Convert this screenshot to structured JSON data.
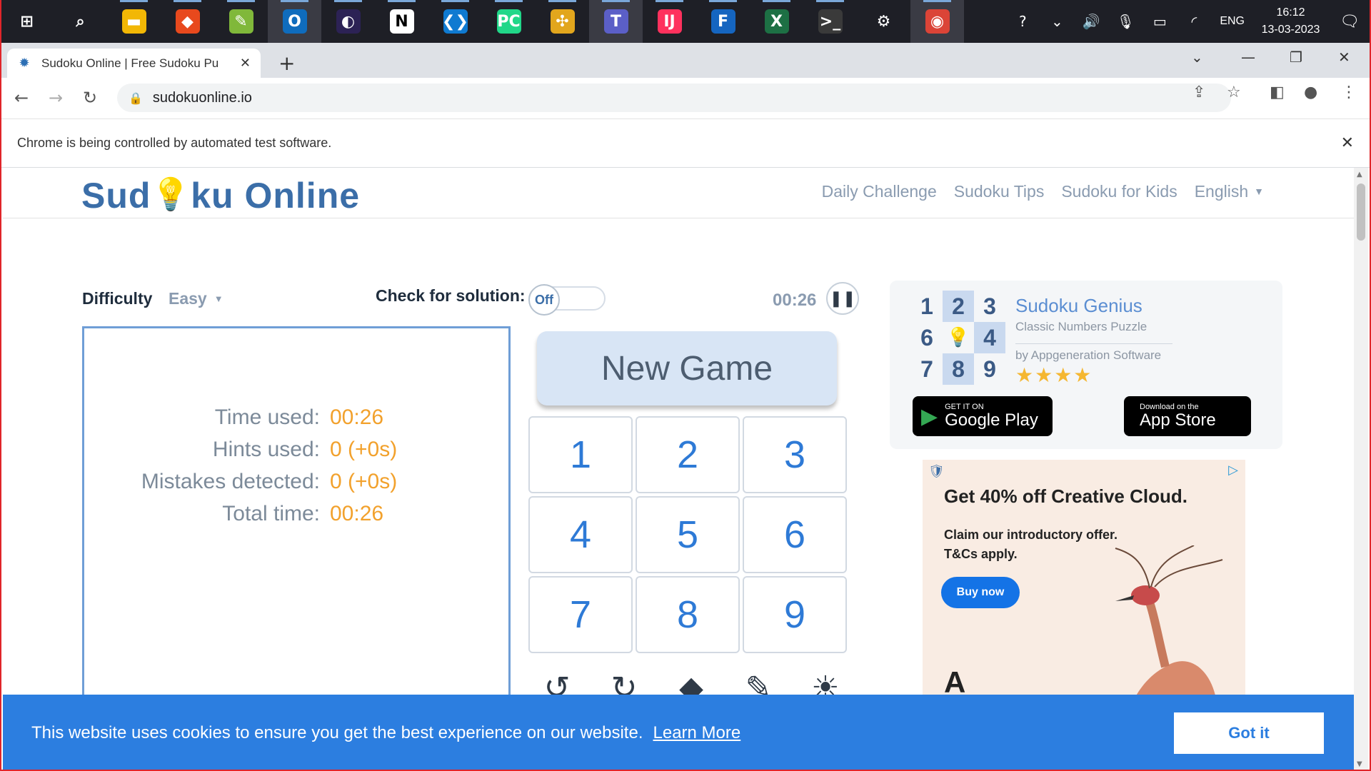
{
  "taskbar": {
    "apps": [
      {
        "name": "windows-start-icon",
        "glyph": "⊞",
        "bg": "transparent"
      },
      {
        "name": "search-icon",
        "glyph": "⌕",
        "bg": "transparent"
      },
      {
        "name": "file-explorer-icon",
        "glyph": "▬",
        "bg": "#f2b705"
      },
      {
        "name": "brave-browser-icon",
        "glyph": "◆",
        "bg": "#e8491d"
      },
      {
        "name": "notepadplusplus-icon",
        "glyph": "✎",
        "bg": "#80b83a"
      },
      {
        "name": "outlook-icon",
        "glyph": "O",
        "bg": "#0f6cbd"
      },
      {
        "name": "eclipse-icon",
        "glyph": "◐",
        "bg": "#2c2255"
      },
      {
        "name": "notion-icon",
        "glyph": "N",
        "bg": "#ffffff"
      },
      {
        "name": "vscode-icon",
        "glyph": "❮❯",
        "bg": "#0f7ad1"
      },
      {
        "name": "pycharm-icon",
        "glyph": "PC",
        "bg": "#21d789"
      },
      {
        "name": "puzzle-app-icon",
        "glyph": "✣",
        "bg": "#e2a61d"
      },
      {
        "name": "teams-icon",
        "glyph": "T",
        "bg": "#5b5fc7"
      },
      {
        "name": "intellij-icon",
        "glyph": "IJ",
        "bg": "#fe315d"
      },
      {
        "name": "f-app-icon",
        "glyph": "F",
        "bg": "#1565c0"
      },
      {
        "name": "excel-icon",
        "glyph": "X",
        "bg": "#1d7044"
      },
      {
        "name": "terminal-icon",
        "glyph": ">_",
        "bg": "#3a3a3a"
      },
      {
        "name": "settings-icon",
        "glyph": "⚙",
        "bg": "transparent"
      },
      {
        "name": "chrome-icon",
        "glyph": "◉",
        "bg": "#db4437"
      }
    ],
    "tray": {
      "language": "ENG",
      "time": "16:12",
      "date": "13-03-2023"
    }
  },
  "browser": {
    "tab_title": "Sudoku Online | Free Sudoku Pu",
    "url": "sudokuonline.io",
    "infobar_text": "Chrome is being controlled by automated test software."
  },
  "site": {
    "logo_prefix": "Sud",
    "logo_suffix": "ku Online",
    "nav": [
      "Daily Challenge",
      "Sudoku Tips",
      "Sudoku for Kids",
      "English"
    ]
  },
  "game": {
    "difficulty_label": "Difficulty",
    "difficulty_value": "Easy",
    "check_label": "Check for solution:",
    "toggle_state": "Off",
    "timer": "00:26",
    "stats": [
      {
        "label": "Time used:",
        "value": "00:26"
      },
      {
        "label": "Hints used:",
        "value": "0 (+0s)"
      },
      {
        "label": "Mistakes detected:",
        "value": "0 (+0s)"
      },
      {
        "label": "Total time:",
        "value": "00:26"
      }
    ],
    "new_game_label": "New Game",
    "numbers": [
      "1",
      "2",
      "3",
      "4",
      "5",
      "6",
      "7",
      "8",
      "9"
    ],
    "tools": [
      {
        "name": "undo-icon",
        "glyph": "↺"
      },
      {
        "name": "redo-icon",
        "glyph": "↻"
      },
      {
        "name": "eraser-icon",
        "glyph": "◆"
      },
      {
        "name": "pencil-icon",
        "glyph": "✎"
      },
      {
        "name": "hint-lightbulb-icon",
        "glyph": "☀"
      }
    ]
  },
  "promo": {
    "grid": [
      "1",
      "2",
      "3",
      "6",
      "",
      "4",
      "7",
      "8",
      "9"
    ],
    "title": "Sudoku Genius",
    "subtitle": "Classic Numbers Puzzle",
    "by": "by Appgeneration Software",
    "stars": "★★★★",
    "google_small": "GET IT ON",
    "google_big": "Google Play",
    "apple_small": "Download on the",
    "apple_big": "App Store"
  },
  "ad": {
    "headline": "Get 40% off Creative Cloud.",
    "body_line1": "Claim our introductory offer.",
    "body_line2": "T&Cs apply.",
    "cta": "Buy now",
    "brand_colors": {
      "cta": "#1473e6",
      "background": "#f9ece3"
    }
  },
  "cookie": {
    "message": "This website uses cookies to ensure you get the best experience on our website.",
    "learn_more": "Learn More",
    "accept": "Got it"
  }
}
